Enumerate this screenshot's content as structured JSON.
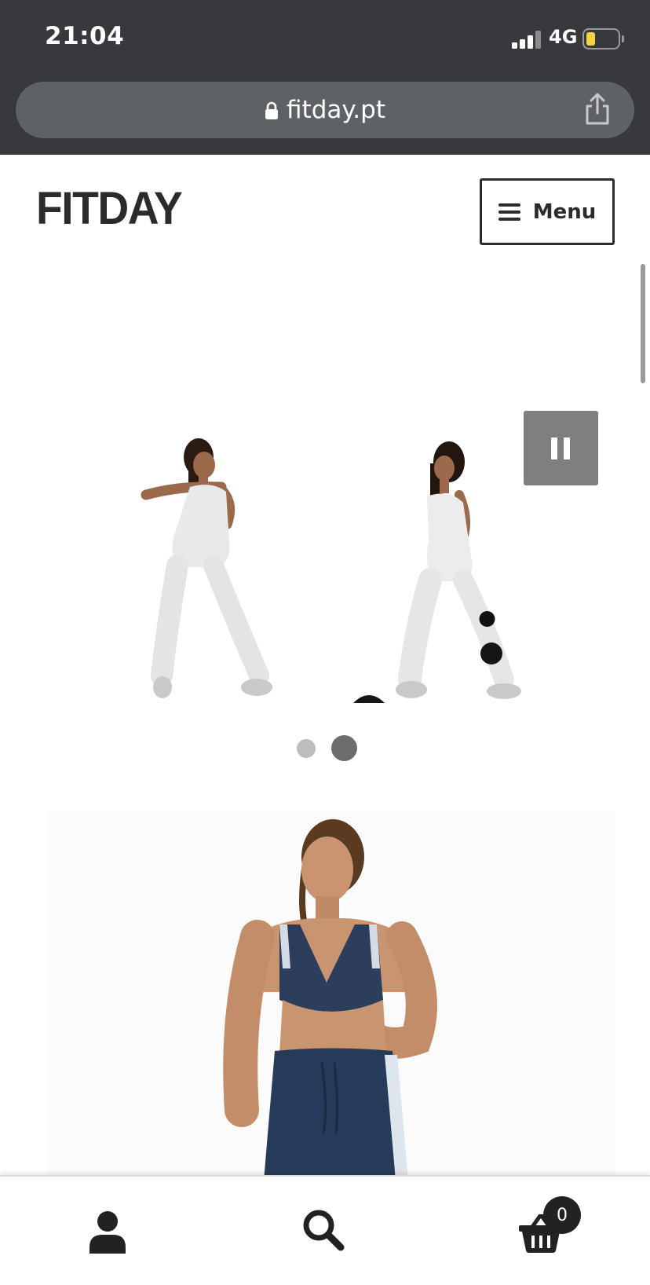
{
  "status_bar": {
    "time": "21:04",
    "network": "4G"
  },
  "browser": {
    "url": "fitday.pt",
    "icons": [
      "lock-icon",
      "share-icon"
    ]
  },
  "header": {
    "site_title": "FITDAY",
    "menu_label": "Menu",
    "menu_icon": "hamburger-icon"
  },
  "slider": {
    "slide_count": 2,
    "active_slide": 2,
    "pause_icon": "pause-icon",
    "image_alt": "Two women in white jumpsuits exercising"
  },
  "product": {
    "image_alt": "Woman in navy sports bra and leggings"
  },
  "bottom_bar": {
    "account_icon": "user-icon",
    "search_icon": "search-icon",
    "cart_icon": "basket-icon",
    "cart_count": "0"
  },
  "colors": {
    "chrome_bg": "#38393d",
    "url_bar_bg": "#5f6265",
    "pause_bg": "#7f7f7f",
    "dot_active": "#6d6d6d",
    "dot_inactive": "#bdbdbd",
    "battery_fill": "#f5d443"
  }
}
